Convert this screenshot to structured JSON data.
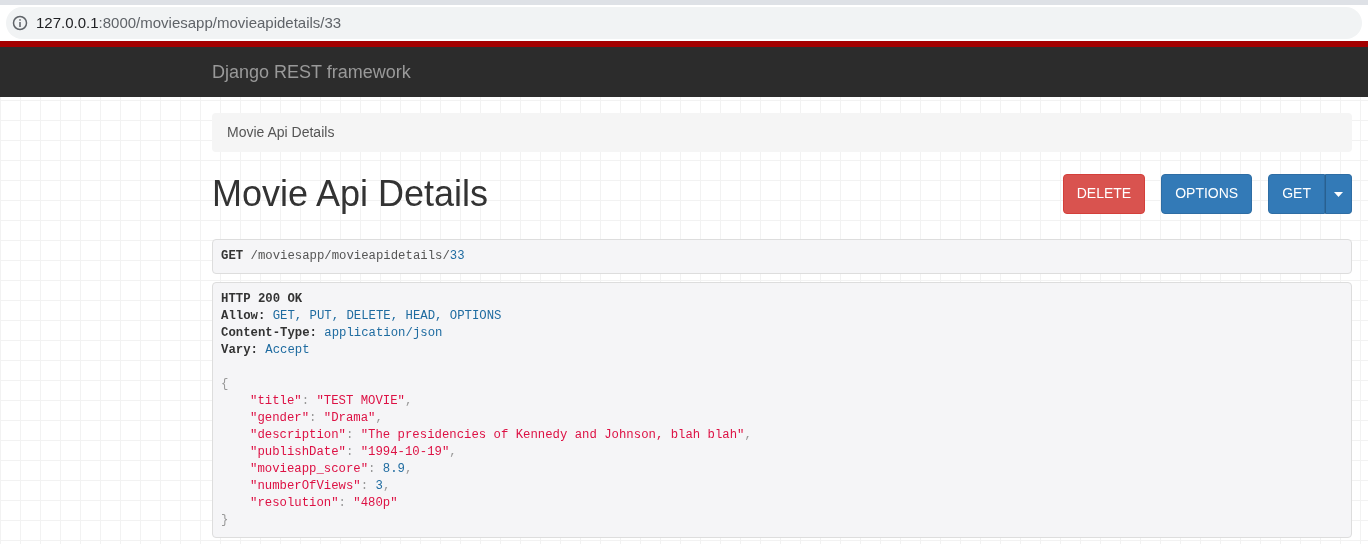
{
  "address_bar": {
    "host": "127.0.0.1",
    "path": ":8000/moviesapp/movieapidetails/33"
  },
  "navbar": {
    "brand": "Django REST framework"
  },
  "breadcrumb": [
    "Movie Api Details"
  ],
  "title": "Movie Api Details",
  "buttons": [
    {
      "label": "DELETE",
      "kind": "danger"
    },
    {
      "label": "OPTIONS",
      "kind": "primary"
    },
    {
      "label": "GET",
      "kind": "split"
    }
  ],
  "request": {
    "method": "GET",
    "path": "/moviesapp/movieapidetails/",
    "id": "33"
  },
  "response": {
    "status": "HTTP 200 OK",
    "headers": [
      {
        "name": "Allow:",
        "value": "GET, PUT, DELETE, HEAD, OPTIONS"
      },
      {
        "name": "Content-Type:",
        "value": "application/json"
      },
      {
        "name": "Vary:",
        "value": "Accept"
      }
    ],
    "open": "{",
    "fields": [
      {
        "key": "\"title\"",
        "colon": ":",
        "value": "\"TEST MOVIE\"",
        "kind": "string",
        "comma": ","
      },
      {
        "key": "\"gender\"",
        "colon": ":",
        "value": "\"Drama\"",
        "kind": "string",
        "comma": ","
      },
      {
        "key": "\"description\"",
        "colon": ":",
        "value": "\"The presidencies of Kennedy and Johnson, blah blah\"",
        "kind": "string",
        "comma": ","
      },
      {
        "key": "\"publishDate\"",
        "colon": ":",
        "value": "\"1994-10-19\"",
        "kind": "string",
        "comma": ","
      },
      {
        "key": "\"movieapp_score\"",
        "colon": ":",
        "value": "8.9",
        "kind": "number",
        "comma": ","
      },
      {
        "key": "\"numberOfViews\"",
        "colon": ":",
        "value": "3",
        "kind": "number",
        "comma": ","
      },
      {
        "key": "\"resolution\"",
        "colon": ":",
        "value": "\"480p\"",
        "kind": "string"
      }
    ],
    "close": "}"
  }
}
